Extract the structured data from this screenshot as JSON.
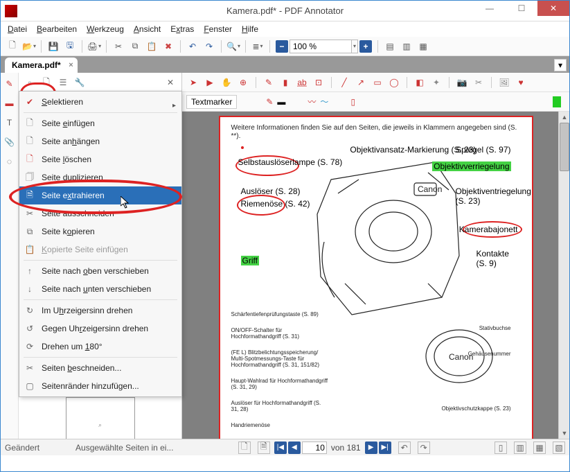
{
  "window": {
    "title": "Kamera.pdf* - PDF Annotator"
  },
  "menubar": [
    "Datei",
    "Bearbeiten",
    "Werkzeug",
    "Ansicht",
    "Extras",
    "Fenster",
    "Hilfe"
  ],
  "toolbar": {
    "zoom_value": "100 %"
  },
  "tab": {
    "label": "Kamera.pdf*"
  },
  "sidebar_menu_top": {
    "items": [
      {
        "id": "selektieren",
        "label": "Selektieren",
        "icon": "check",
        "has_sub": true
      },
      {
        "sep": true
      },
      {
        "id": "einfuegen",
        "label": "Seite einfügen",
        "icon": "page-insert"
      },
      {
        "id": "anhaengen",
        "label": "Seite anhängen",
        "icon": "page-append"
      },
      {
        "id": "loeschen",
        "label": "Seite löschen",
        "icon": "page-delete"
      },
      {
        "id": "duplizieren",
        "label": "Seite duplizieren",
        "icon": "page-dup"
      },
      {
        "id": "extrahieren",
        "label": "Seite extrahieren",
        "icon": "page-extract",
        "selected": true
      },
      {
        "id": "ausschneiden",
        "label": "Seite ausschneiden",
        "icon": "cut"
      },
      {
        "id": "kopieren",
        "label": "Seite kopieren",
        "icon": "copy"
      },
      {
        "id": "einfuegen-kopie",
        "label": "Kopierte Seite einfügen",
        "icon": "paste",
        "disabled": true
      },
      {
        "sep": true
      },
      {
        "id": "nach-oben",
        "label": "Seite nach oben verschieben",
        "icon": "arrow-up"
      },
      {
        "id": "nach-unten",
        "label": "Seite nach unten verschieben",
        "icon": "arrow-down"
      },
      {
        "sep": true
      },
      {
        "id": "uhrzeiger",
        "label": "Im Uhrzeigersinn drehen",
        "icon": "rotate-cw"
      },
      {
        "id": "gegen-uhrzeiger",
        "label": "Gegen Uhrzeigersinn drehen",
        "icon": "rotate-ccw"
      },
      {
        "id": "drehen180",
        "label": "Drehen um 180°",
        "icon": "rotate-180"
      },
      {
        "sep": true
      },
      {
        "id": "beschneiden",
        "label": "Seiten beschneiden...",
        "icon": "crop"
      },
      {
        "id": "seitenraender",
        "label": "Seitenränder hinzufügen...",
        "icon": "margins"
      }
    ]
  },
  "annobar2": {
    "textmarker_label": "Textmarker"
  },
  "page_content": {
    "intro": "Weitere Informationen finden Sie auf den Seiten, die jeweils in Klammern angegeben sind (S. **).",
    "callouts_top": [
      "Objektivansatz-Markierung (S. 23)",
      "Spiegel (S. 97)"
    ],
    "callouts_left": [
      "Selbstauslöserlampe (S. 78)",
      "Auslöser (S. 28)",
      "Riemenöse (S. 42)",
      "Griff"
    ],
    "callouts_right": [
      "Objektivverriegelung",
      "Objektiventriegelung (S. 23)",
      "Kamerabajonett",
      "Kontakte (S. 9)"
    ],
    "callouts_bottom_left": [
      "Schärfentiefenprüfungstaste (S. 89)",
      "ON/OFF-Schalter für Hochformathandgriff (S. 31)",
      "(FE L) Blitzbelichtungsspeicherung/ Multi-Spotmessungs-Taste für Hochformathandgriff (S. 31, 151/82)",
      "Haupt-Wahlrad für Hochformathandgriff (S. 31, 29)",
      "Auslöser für Hochformathandgriff (S. 31, 28)",
      "Handriemenöse"
    ],
    "callouts_bottom_right": [
      "Stativbuchse",
      "Gehäusenummer",
      "Objektivschutzkappe (S. 23)"
    ]
  },
  "statusbar": {
    "left": "Geändert",
    "hint": "Ausgewählte Seiten in ei...",
    "page_current": "10",
    "page_total": "181",
    "page_of": "von"
  }
}
